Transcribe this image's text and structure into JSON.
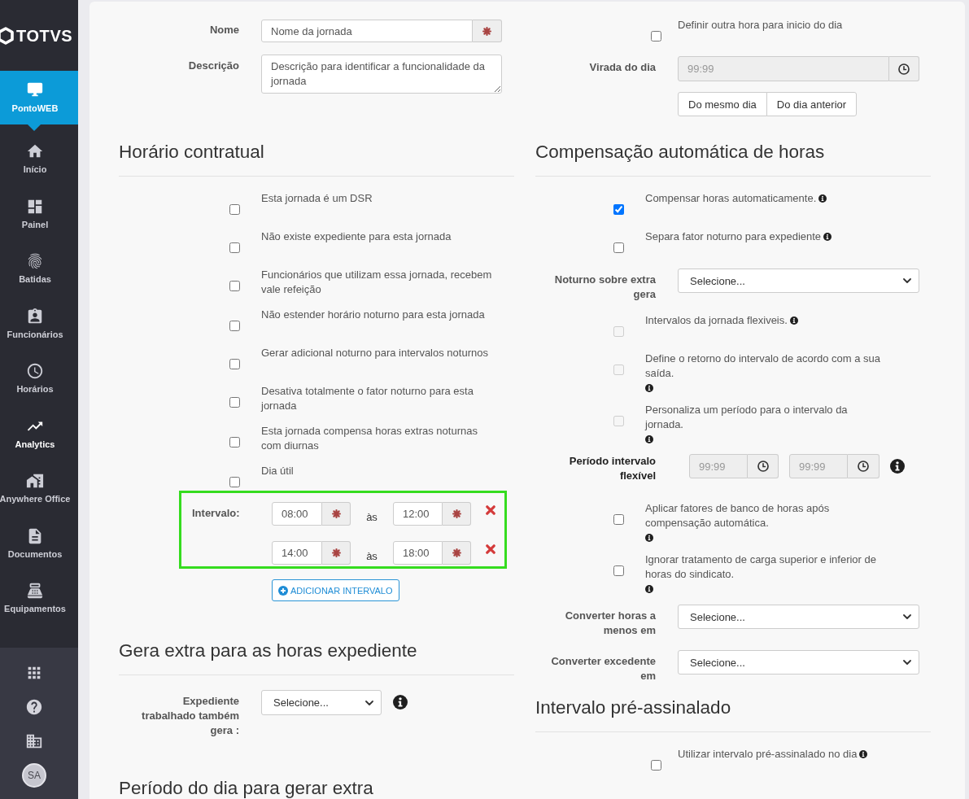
{
  "sidebar": {
    "logo": "TOTVS",
    "items": [
      {
        "label": "PontoWEB",
        "selected": true,
        "highlighted": false
      },
      {
        "label": "Início",
        "selected": false,
        "highlighted": false
      },
      {
        "label": "Painel",
        "selected": false,
        "highlighted": false
      },
      {
        "label": "Batidas",
        "selected": false,
        "highlighted": false
      },
      {
        "label": "Funcionários",
        "selected": false,
        "highlighted": false
      },
      {
        "label": "Horários",
        "selected": false,
        "highlighted": false
      },
      {
        "label": "Analytics",
        "selected": false,
        "highlighted": true
      },
      {
        "label": "Anywhere Office",
        "selected": false,
        "highlighted": false
      },
      {
        "label": "Documentos",
        "selected": false,
        "highlighted": false
      },
      {
        "label": "Equipamentos",
        "selected": false,
        "highlighted": false
      }
    ],
    "avatar": "SA"
  },
  "form": {
    "name_field": {
      "label": "Nome",
      "value": "Nome da jornada",
      "required": true
    },
    "description_field": {
      "label": "Descrição",
      "value": "Descrição para identificar a funcionalidade da jornada"
    },
    "day_start": {
      "option": {
        "label": "Definir outra hora para inicio do dia",
        "checked": false
      },
      "label": "Virada do dia",
      "placeholder": "99:99",
      "disabled": true,
      "choices": [
        {
          "label": "Do mesmo dia",
          "selected": false
        },
        {
          "label": "Do dia anterior",
          "selected": false
        }
      ]
    },
    "contract_hours": {
      "title": "Horário contratual",
      "options": [
        {
          "label": "Esta jornada é um DSR",
          "checked": false
        },
        {
          "label": "Não existe expediente para esta jornada",
          "checked": false
        },
        {
          "label": "Funcionários que utilizam essa jornada, recebem vale refeição",
          "checked": false
        },
        {
          "label": "Não estender horário noturno para esta jornada",
          "checked": false
        },
        {
          "label": "Gerar adicional noturno para intervalos noturnos",
          "checked": false
        },
        {
          "label": "Desativa totalmente o fator noturno para esta jornada",
          "checked": false
        },
        {
          "label": "Esta jornada compensa horas extras noturnas com diurnas",
          "checked": false
        },
        {
          "label": "Dia útil",
          "checked": false
        }
      ],
      "intervals": {
        "label": "Intervalo:",
        "required": true,
        "rows": [
          {
            "start": "08:00",
            "separator": "às",
            "end": "12:00"
          },
          {
            "start": "14:00",
            "separator": "às",
            "end": "18:00"
          }
        ]
      },
      "add_button": "ADICIONAR INTERVALO"
    },
    "extra_hours": {
      "title": "Gera extra para as horas expediente",
      "label": "Expediente trabalhado também gera :",
      "value": "Selecione...",
      "info": true
    },
    "day_period": {
      "title": "Período do dia para gerar extra"
    },
    "auto_compensation": {
      "title": "Compensação automática de horas",
      "items": [
        {
          "kind": "checkbox",
          "label": "Compensar horas automaticamente.",
          "checked": true,
          "disabled": false,
          "info": true
        },
        {
          "kind": "checkbox",
          "label": "Separa fator noturno para expediente",
          "checked": false,
          "disabled": false,
          "info": true
        },
        {
          "kind": "select",
          "label": "Noturno sobre extra gera",
          "value": "Selecione..."
        },
        {
          "kind": "checkbox",
          "label": "Intervalos da jornada flexiveis.",
          "checked": false,
          "disabled": true,
          "info": true
        },
        {
          "kind": "checkbox_stacked",
          "label": "Define o retorno do intervalo de acordo com a sua saída.",
          "checked": false,
          "disabled": true,
          "info": true
        },
        {
          "kind": "checkbox_stacked",
          "label": "Personaliza um período para o intervalo da jornada.",
          "checked": false,
          "disabled": true,
          "info": true
        },
        {
          "kind": "time_range",
          "label": "Período intervalo flexível",
          "start_placeholder": "99:99",
          "end_placeholder": "99:99",
          "disabled": true,
          "info": true
        },
        {
          "kind": "checkbox_stacked",
          "label": "Aplicar fatores de banco de horas após compensação automática.",
          "checked": false,
          "disabled": false,
          "info": true
        },
        {
          "kind": "checkbox_stacked",
          "label": "Ignorar tratamento de carga superior e inferior de horas do sindicato.",
          "checked": false,
          "disabled": false,
          "info": true
        },
        {
          "kind": "select",
          "label": "Converter horas a menos em",
          "value": "Selecione..."
        },
        {
          "kind": "select",
          "label": "Converter excedente em",
          "value": "Selecione..."
        }
      ]
    },
    "pre_marked": {
      "title": "Intervalo pré-assinalado",
      "options": [
        {
          "label": "Utilizar intervalo pré-assinalado no dia",
          "checked": false,
          "info": true
        }
      ]
    }
  }
}
